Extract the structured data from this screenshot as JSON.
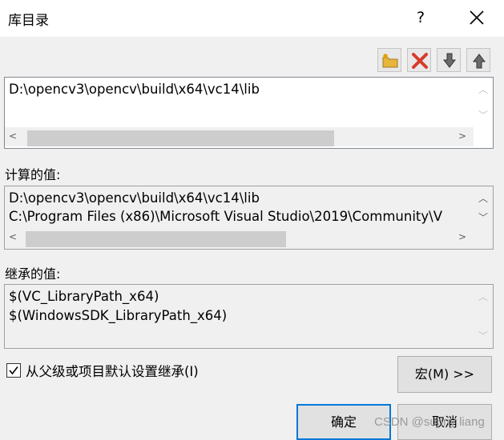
{
  "window": {
    "title": "库目录",
    "help_label": "?"
  },
  "toolbar": {
    "buttons": [
      {
        "name": "new-folder-icon"
      },
      {
        "name": "delete-icon"
      },
      {
        "name": "arrow-down-icon"
      },
      {
        "name": "arrow-up-icon"
      }
    ]
  },
  "editor": {
    "lines": [
      "D:\\opencv3\\opencv\\build\\x64\\vc14\\lib"
    ]
  },
  "computed": {
    "label": "计算的值:",
    "lines": [
      "D:\\opencv3\\opencv\\build\\x64\\vc14\\lib",
      "C:\\Program Files (x86)\\Microsoft Visual Studio\\2019\\Community\\V"
    ]
  },
  "inherited": {
    "label": "继承的值:",
    "lines": [
      "$(VC_LibraryPath_x64)",
      "$(WindowsSDK_LibraryPath_x64)"
    ]
  },
  "inherit_checkbox": {
    "label": "从父级或项目默认设置继承(I)",
    "checked": true
  },
  "buttons": {
    "macros": "宏(M) >>",
    "ok": "确定",
    "cancel": "取消"
  },
  "watermark": "CSDN @sunny liang",
  "colors": {
    "accent": "#0078d7",
    "delete_red": "#d83b2a",
    "folder_yellow": "#e8b53b"
  }
}
